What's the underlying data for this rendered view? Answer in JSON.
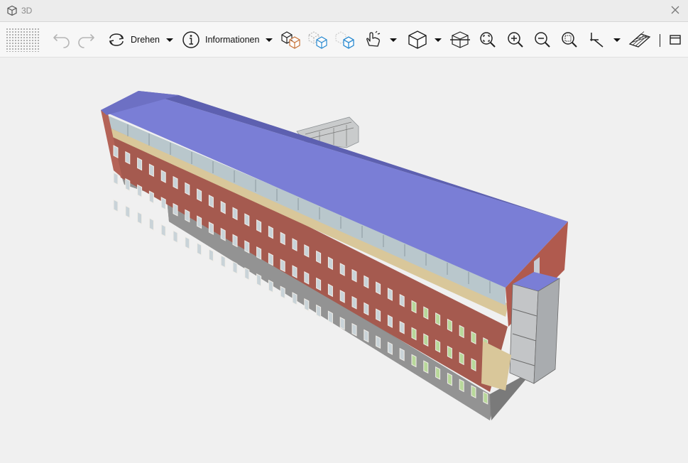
{
  "window": {
    "title": "3D"
  },
  "toolbar": {
    "rotate_label": "Drehen",
    "info_label": "Informationen"
  },
  "colors": {
    "roof": "#7a7ed6",
    "brick": "#a55a4f",
    "sand_band": "#d9c79a",
    "base": "#8a8a8a",
    "glass": "#b9c7cc",
    "accent_blue": "#2a8ad0",
    "accent_orange": "#c8743a"
  },
  "icons": [
    "cube-icon",
    "close-icon",
    "grip-icon",
    "undo-icon",
    "redo-icon",
    "rotate-icon",
    "info-icon",
    "show-objects-icon",
    "hide-objects-icon",
    "isolate-object-icon",
    "hand-pointer-icon",
    "view-cube-icon",
    "section-box-icon",
    "zoom-extents-icon",
    "zoom-in-icon",
    "zoom-out-icon",
    "zoom-window-icon",
    "measure-icon",
    "grid-plane-icon",
    "window-icon"
  ]
}
